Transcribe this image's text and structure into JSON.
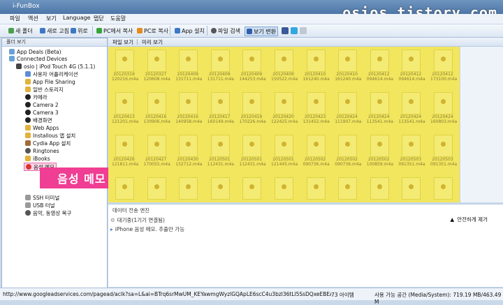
{
  "window": {
    "title": "i-FunBox",
    "watermark": "osios.tistory.com"
  },
  "menu": [
    "파일",
    "액션",
    "보기",
    "Language",
    "탭닫",
    "도움말"
  ],
  "toolbar": [
    {
      "label": "새 폴더",
      "icon": "new-folder-icon"
    },
    {
      "label": "새로 고침",
      "icon": "refresh-icon"
    },
    {
      "label": "위로",
      "icon": "up-icon"
    },
    {
      "label": "PC에서 복사",
      "icon": "copy-from-pc-icon"
    },
    {
      "label": "PC로 복사",
      "icon": "copy-to-pc-icon"
    },
    {
      "label": "App 설치",
      "icon": "app-install-icon"
    },
    {
      "label": "파일 검색",
      "icon": "search-icon"
    },
    {
      "label": "보기 변환",
      "icon": "view-icon"
    }
  ],
  "left_header": "폴더 보기",
  "tree": [
    {
      "label": "App Deals (Beta)"
    },
    {
      "label": "Connected Devices"
    },
    {
      "label": "osio | iPod Touch 4G (5.1.1)"
    },
    {
      "label": "사용자 어플리케이션"
    },
    {
      "label": "App File Sharing"
    },
    {
      "label": "일반 스토리지"
    },
    {
      "label": "카메라"
    },
    {
      "label": "Camera 2"
    },
    {
      "label": "Camera 3"
    },
    {
      "label": "배경화면"
    },
    {
      "label": "Web Apps"
    },
    {
      "label": "Installous 앱 설치"
    },
    {
      "label": "Cydia App 설치"
    },
    {
      "label": "Ringtones"
    },
    {
      "label": "iBooks"
    },
    {
      "label": "음성 메모"
    },
    {
      "label": "SSH 터미널"
    },
    {
      "label": "USB 터널"
    },
    {
      "label": "음악, 동영상 복구"
    }
  ],
  "overlay": "음성 메모 탭",
  "view_tabs": [
    "파일 보기",
    "미리 보기"
  ],
  "files": [
    "20120319\n120216.m4a",
    "20120327\n120608.m4a",
    "20120409\n131711.m4a",
    "20120409\n131711.m4a",
    "20120409\n144253.m4a",
    "20120409\n150522.m4a",
    "20120410\n161240.m4a",
    "20120410\n161240.m4a",
    "20120412\n094614.m4a",
    "20120412\n094614.m4a",
    "20120412\n173100.m4a",
    "20120413\n121201.m4a",
    "20120416\n130906.m4a",
    "20120416\n140958.m4a",
    "20120417\n160149.m4a",
    "20120419\n170226.m4a",
    "20120420\n122425.m4a",
    "20120423\n131452.m4a",
    "20120424\n111907.m4a",
    "20120424\n113541.m4a",
    "20120424\n113541.m4a",
    "20120424\n160803.m4a",
    "20120426\n121811.m4a",
    "20120427\n170055.m4a",
    "20120430\n132712.m4a",
    "20120501\n112431.m4a",
    "20120501\n112431.m4a",
    "20120501\n121445.m4a",
    "20120502\n090736.m4a",
    "20120502\n090736.m4a",
    "20120502\n100859.m4a",
    "20120503\n091351.m4a",
    "20120503\n091351.m4a",
    "",
    "",
    "",
    "",
    "",
    "",
    "",
    "",
    "",
    "",
    ""
  ],
  "transfer": {
    "header": "데이터 전송 엔진",
    "waiting": "대기중(1기기 연결됨)",
    "note": "iPhone 음성 메모. 추출만 가능",
    "eject": "안전하게 제거"
  },
  "status": {
    "url": "http://www.googleadservices.com/pagead/aclk?sa=L&ai=BTrq6srMwUM_KEYawmgWyzlGQApLE6scC4u3bzl36tLl5SsDQxeEBEAEYASCpq7wU",
    "count": "73 아이템",
    "disk": "사용 가능 공간 (Media/System): 719.19 MB/463.49 M"
  }
}
